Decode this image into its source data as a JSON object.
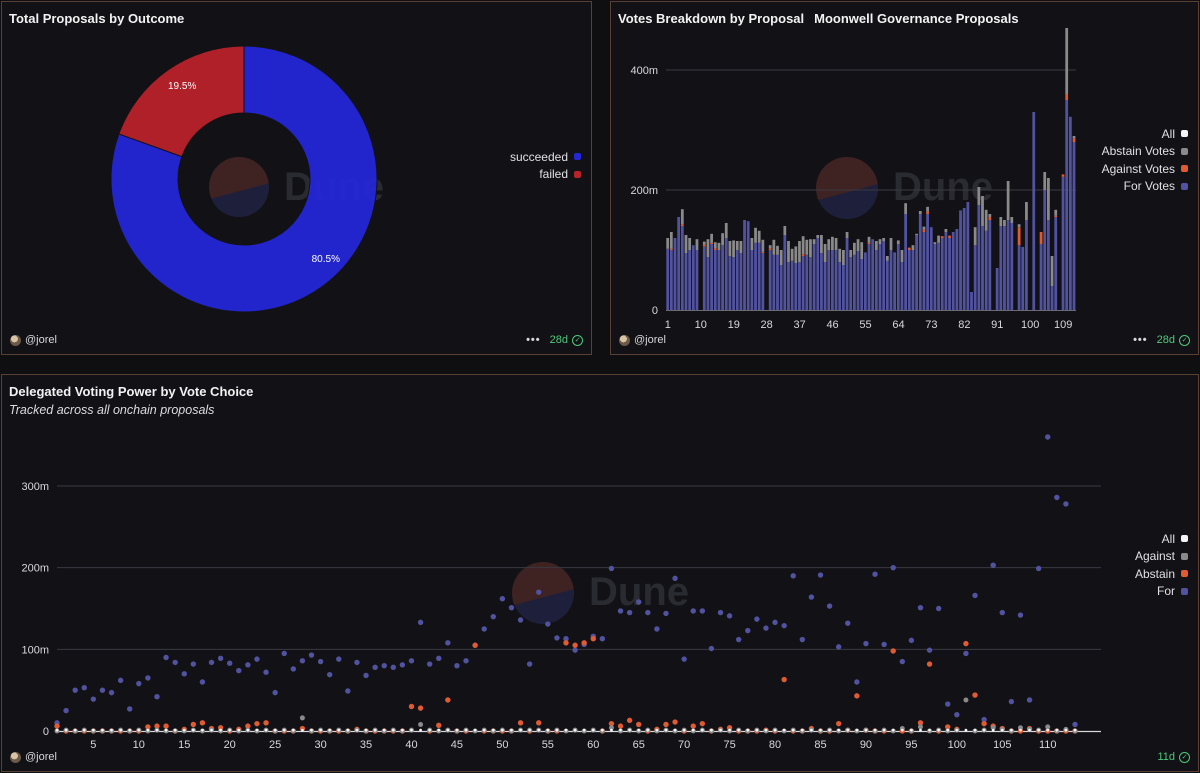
{
  "colors": {
    "bg": "#121216",
    "succeeded": "#2427d6",
    "failed": "#b82229",
    "for": "#5253a0",
    "against": "#e05a32",
    "abstain": "#8a8a8a",
    "all": "#f4f4f4",
    "ok": "#4ec97a"
  },
  "watermark": "Dune",
  "panel1": {
    "title": "Total Proposals by Outcome",
    "user": "@jorel",
    "menu": "•••",
    "age": "28d",
    "legend": [
      {
        "label": "succeeded",
        "color": "#2427d6"
      },
      {
        "label": "failed",
        "color": "#b82229"
      }
    ],
    "chart_data": {
      "type": "pie",
      "labels": [
        "succeeded",
        "failed"
      ],
      "values": [
        80.5,
        19.5
      ],
      "value_labels": [
        "80.5%",
        "19.5%"
      ],
      "donut": true
    }
  },
  "panel2": {
    "title": "Votes Breakdown by Proposal",
    "subtitle": "Moonwell Governance Proposals",
    "user": "@jorel",
    "menu": "•••",
    "age": "28d",
    "legend": [
      {
        "label": "All",
        "color": "#f4f4f4"
      },
      {
        "label": "Abstain Votes",
        "color": "#8a8a8a"
      },
      {
        "label": "Against Votes",
        "color": "#e05a32"
      },
      {
        "label": "For Votes",
        "color": "#5253a0"
      }
    ],
    "chart_data": {
      "type": "bar",
      "stacked": true,
      "x_range": [
        1,
        112
      ],
      "x_ticks": [
        1,
        10,
        19,
        28,
        37,
        46,
        55,
        64,
        73,
        82,
        91,
        100,
        109
      ],
      "y_ticks": [
        0,
        200,
        400
      ],
      "y_tick_labels": [
        "0",
        "200m",
        "400m"
      ],
      "ylim": [
        0,
        480
      ],
      "unit": "m",
      "series": [
        {
          "name": "For Votes",
          "values": [
            102,
            100,
            120,
            155,
            140,
            95,
            100,
            108,
            100,
            0,
            106,
            88,
            110,
            100,
            100,
            108,
            120,
            90,
            88,
            100,
            95,
            150,
            148,
            100,
            112,
            112,
            95,
            0,
            100,
            92,
            92,
            75,
            125,
            80,
            82,
            78,
            80,
            90,
            92,
            88,
            110,
            120,
            95,
            80,
            100,
            100,
            100,
            80,
            75,
            120,
            88,
            92,
            98,
            85,
            96,
            110,
            118,
            100,
            110,
            115,
            82,
            100,
            96,
            110,
            80,
            160,
            100,
            100,
            125,
            160,
            130,
            160,
            138,
            110,
            112,
            120,
            130,
            120,
            130,
            135,
            166,
            170,
            180,
            30,
            108,
            175,
            140,
            132,
            150,
            0,
            70,
            140,
            140,
            150,
            145,
            0,
            108,
            105,
            150,
            0,
            330,
            0,
            110,
            200,
            150,
            40,
            155,
            0,
            222,
            350,
            322,
            280
          ]
        },
        {
          "name": "Against Votes",
          "values": [
            0,
            2,
            0,
            0,
            3,
            0,
            0,
            0,
            0,
            0,
            3,
            0,
            2,
            3,
            0,
            0,
            0,
            0,
            0,
            0,
            0,
            0,
            0,
            0,
            0,
            0,
            2,
            0,
            3,
            0,
            0,
            0,
            0,
            0,
            0,
            0,
            0,
            3,
            0,
            0,
            0,
            0,
            0,
            0,
            0,
            0,
            0,
            0,
            0,
            0,
            0,
            0,
            0,
            0,
            0,
            2,
            0,
            0,
            0,
            0,
            0,
            0,
            0,
            0,
            0,
            0,
            4,
            0,
            0,
            0,
            4,
            4,
            0,
            0,
            0,
            3,
            0,
            4,
            0,
            0,
            0,
            0,
            0,
            0,
            0,
            0,
            0,
            0,
            5,
            0,
            0,
            0,
            0,
            0,
            0,
            0,
            30,
            0,
            0,
            0,
            0,
            0,
            20,
            0,
            0,
            0,
            2,
            0,
            4,
            10,
            0,
            6
          ]
        },
        {
          "name": "Abstain Votes",
          "values": [
            18,
            28,
            0,
            0,
            25,
            30,
            20,
            0,
            18,
            0,
            5,
            30,
            15,
            10,
            12,
            20,
            25,
            25,
            28,
            15,
            20,
            0,
            0,
            20,
            25,
            20,
            20,
            0,
            5,
            25,
            15,
            25,
            15,
            35,
            20,
            28,
            35,
            30,
            25,
            30,
            8,
            5,
            30,
            30,
            18,
            22,
            20,
            22,
            25,
            10,
            12,
            20,
            20,
            28,
            0,
            10,
            0,
            15,
            8,
            5,
            8,
            20,
            0,
            6,
            20,
            18,
            0,
            8,
            2,
            5,
            5,
            8,
            0,
            3,
            12,
            0,
            5,
            0,
            0,
            0,
            0,
            0,
            0,
            0,
            30,
            30,
            50,
            35,
            5,
            0,
            0,
            15,
            10,
            65,
            10,
            0,
            5,
            0,
            30,
            0,
            0,
            0,
            0,
            30,
            70,
            50,
            10,
            0,
            0,
            110,
            0,
            4
          ]
        }
      ]
    }
  },
  "panel3": {
    "title": "Delegated Voting Power by Vote Choice",
    "subtitle": "Tracked across all onchain proposals",
    "user": "@jorel",
    "age": "11d",
    "legend": [
      {
        "label": "All",
        "color": "#f4f4f4"
      },
      {
        "label": "Against",
        "color": "#8a8a8a"
      },
      {
        "label": "Abstain",
        "color": "#e05a32"
      },
      {
        "label": "For",
        "color": "#5253a0"
      }
    ],
    "chart_data": {
      "type": "scatter",
      "x_range": [
        1,
        113
      ],
      "x_ticks": [
        5,
        10,
        15,
        20,
        25,
        30,
        35,
        40,
        45,
        50,
        55,
        60,
        65,
        70,
        75,
        80,
        85,
        90,
        95,
        100,
        105,
        110
      ],
      "y_ticks": [
        0,
        100,
        200,
        300
      ],
      "y_tick_labels": [
        "0",
        "100m",
        "200m",
        "300m"
      ],
      "ylim": [
        0,
        360
      ],
      "unit": "m",
      "series": [
        {
          "name": "For",
          "values": [
            10,
            25,
            50,
            53,
            39,
            50,
            47,
            62,
            27,
            58,
            65,
            42,
            90,
            84,
            70,
            82,
            60,
            84,
            89,
            83,
            74,
            81,
            88,
            72,
            47,
            95,
            76,
            86,
            93,
            85,
            69,
            88,
            49,
            84,
            68,
            78,
            80,
            78,
            81,
            86,
            133,
            82,
            89,
            108,
            80,
            86,
            105,
            125,
            140,
            162,
            151,
            136,
            82,
            170,
            131,
            114,
            113,
            99,
            106,
            116,
            113,
            199,
            147,
            145,
            158,
            145,
            125,
            144,
            187,
            88,
            147,
            147,
            101,
            145,
            141,
            112,
            123,
            137,
            126,
            133,
            129,
            190,
            112,
            164,
            191,
            153,
            103,
            132,
            60,
            107,
            192,
            106,
            200,
            85,
            111,
            151,
            99,
            150,
            33,
            20,
            95,
            166,
            14,
            203,
            145,
            36,
            142,
            38,
            199,
            360,
            286,
            278,
            8
          ]
        },
        {
          "name": "Abstain",
          "values": [
            6,
            0,
            0,
            0,
            0,
            0,
            0,
            0,
            0,
            0,
            5,
            6,
            6,
            0,
            2,
            8,
            10,
            3,
            4,
            0,
            2,
            6,
            9,
            10,
            0,
            0,
            0,
            3,
            0,
            0,
            0,
            0,
            0,
            2,
            0,
            0,
            0,
            0,
            0,
            30,
            28,
            0,
            7,
            38,
            0,
            0,
            105,
            0,
            0,
            0,
            0,
            10,
            0,
            10,
            0,
            0,
            108,
            105,
            108,
            113,
            0,
            9,
            6,
            13,
            8,
            0,
            2,
            8,
            11,
            0,
            6,
            9,
            0,
            2,
            4,
            0,
            0,
            0,
            1,
            0,
            63,
            0,
            0,
            3,
            0,
            0,
            9,
            1,
            43,
            1,
            0,
            0,
            98,
            0,
            0,
            10,
            82,
            0,
            5,
            2,
            107,
            44,
            9,
            6,
            3,
            0,
            0,
            3,
            0,
            0,
            0,
            0,
            0
          ]
        },
        {
          "name": "Against",
          "values": [
            0,
            1,
            0,
            1,
            0,
            0,
            0,
            1,
            0,
            1,
            0,
            1,
            0,
            0,
            0,
            1,
            0,
            1,
            0,
            1,
            0,
            1,
            0,
            1,
            0,
            1,
            0,
            16,
            0,
            1,
            0,
            1,
            0,
            1,
            0,
            1,
            0,
            1,
            0,
            1,
            8,
            1,
            0,
            1,
            0,
            1,
            0,
            1,
            0,
            1,
            0,
            1,
            1,
            1,
            0,
            1,
            0,
            1,
            0,
            1,
            0,
            4,
            0,
            1,
            0,
            1,
            0,
            1,
            0,
            1,
            0,
            1,
            0,
            1,
            0,
            1,
            0,
            1,
            0,
            1,
            0,
            1,
            0,
            1,
            0,
            1,
            0,
            1,
            0,
            1,
            0,
            1,
            0,
            3,
            0,
            5,
            0,
            1,
            0,
            1,
            38,
            0,
            1,
            4,
            2,
            0,
            4,
            2,
            1,
            5,
            0,
            2,
            0
          ]
        },
        {
          "name": "All",
          "values": [
            1,
            1,
            1,
            1,
            1,
            1,
            1,
            1,
            1,
            1,
            1,
            1,
            1,
            1,
            1,
            1,
            1,
            1,
            1,
            1,
            1,
            1,
            1,
            1,
            1,
            1,
            1,
            1,
            1,
            1,
            1,
            1,
            1,
            1,
            1,
            1,
            1,
            1,
            1,
            1,
            1,
            1,
            1,
            1,
            1,
            1,
            1,
            1,
            1,
            1,
            1,
            1,
            1,
            1,
            1,
            1,
            1,
            1,
            1,
            1,
            1,
            1,
            1,
            1,
            1,
            1,
            1,
            1,
            1,
            1,
            1,
            1,
            1,
            1,
            1,
            1,
            1,
            1,
            1,
            1,
            1,
            1,
            1,
            1,
            1,
            1,
            1,
            1,
            1,
            1,
            1,
            1,
            1,
            1,
            1,
            1,
            1,
            1,
            1,
            1,
            1,
            1,
            1,
            1,
            1,
            1,
            1,
            1,
            1,
            1,
            1,
            1,
            1
          ]
        }
      ]
    }
  }
}
